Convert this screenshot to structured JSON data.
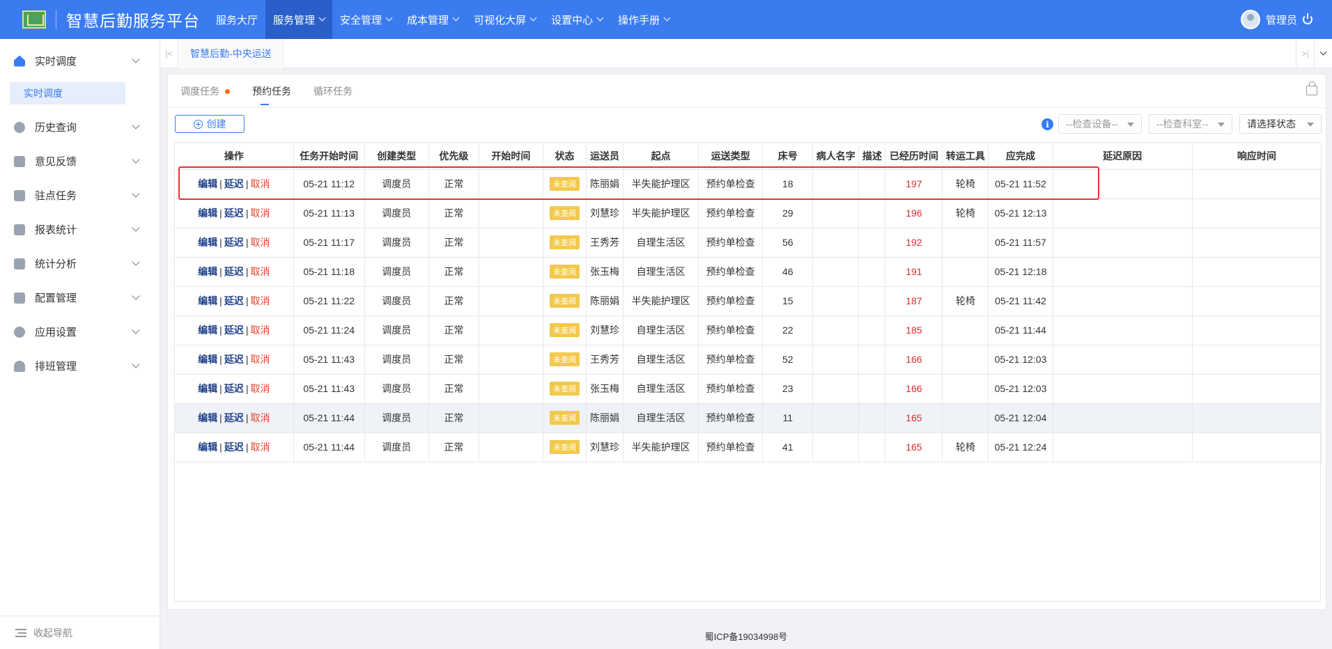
{
  "header": {
    "brand": "智慧后勤服务平台",
    "nav": [
      {
        "label": "服务大厅",
        "dropdown": false,
        "active": false
      },
      {
        "label": "服务管理",
        "dropdown": true,
        "active": true
      },
      {
        "label": "安全管理",
        "dropdown": true,
        "active": false
      },
      {
        "label": "成本管理",
        "dropdown": true,
        "active": false
      },
      {
        "label": "可视化大屏",
        "dropdown": true,
        "active": false
      },
      {
        "label": "设置中心",
        "dropdown": true,
        "active": false
      },
      {
        "label": "操作手册",
        "dropdown": true,
        "active": false
      }
    ],
    "user": "管理员"
  },
  "sidebar": {
    "items": [
      {
        "label": "实时调度",
        "icon": "home-icon",
        "expanded": true
      },
      {
        "label": "历史查询",
        "icon": "history-icon"
      },
      {
        "label": "意见反馈",
        "icon": "edit-icon"
      },
      {
        "label": "驻点任务",
        "icon": "briefcase-icon"
      },
      {
        "label": "报表统计",
        "icon": "bar-chart-icon"
      },
      {
        "label": "统计分析",
        "icon": "analytics-icon"
      },
      {
        "label": "配置管理",
        "icon": "grid-icon"
      },
      {
        "label": "应用设置",
        "icon": "gear-icon"
      },
      {
        "label": "排班管理",
        "icon": "bell-icon"
      }
    ],
    "subitem": "实时调度",
    "collapse": "收起导航"
  },
  "tabsbar": {
    "tab": "智慧后勤-中央运送"
  },
  "subtabs": {
    "dispatch": "调度任务",
    "reserve": "预约任务",
    "loop": "循环任务"
  },
  "toolbar": {
    "create": "创建",
    "device_placeholder": "--检查设备--",
    "dept_placeholder": "--检查科室--",
    "status_placeholder": "请选择状态"
  },
  "table": {
    "headers": [
      "操作",
      "任务开始时间",
      "创建类型",
      "优先级",
      "开始时间",
      "状态",
      "运送员",
      "起点",
      "运送类型",
      "床号",
      "病人名字",
      "描述",
      "已经历时间",
      "转运工具",
      "应完成",
      "延迟原因",
      "响应时间"
    ],
    "ops": {
      "edit": "编辑",
      "delay": "延迟",
      "cancel": "取消"
    },
    "rows": [
      {
        "start": "05-21 11:12",
        "type": "调度员",
        "priority": "正常",
        "begin": "",
        "status": "未查阅",
        "courier": "陈丽娟",
        "origin": "半失能护理区",
        "trans": "预约单检查",
        "bed": "18",
        "patient": "",
        "desc": "",
        "elapsed": "197",
        "tool": "轮椅",
        "due": "05-21 11:52",
        "reason": "",
        "resp": ""
      },
      {
        "start": "05-21 11:13",
        "type": "调度员",
        "priority": "正常",
        "begin": "",
        "status": "未查阅",
        "courier": "刘慧珍",
        "origin": "半失能护理区",
        "trans": "预约单检查",
        "bed": "29",
        "patient": "",
        "desc": "",
        "elapsed": "196",
        "tool": "轮椅",
        "due": "05-21 12:13",
        "reason": "",
        "resp": ""
      },
      {
        "start": "05-21 11:17",
        "type": "调度员",
        "priority": "正常",
        "begin": "",
        "status": "未查阅",
        "courier": "王秀芳",
        "origin": "自理生活区",
        "trans": "预约单检查",
        "bed": "56",
        "patient": "",
        "desc": "",
        "elapsed": "192",
        "tool": "",
        "due": "05-21 11:57",
        "reason": "",
        "resp": ""
      },
      {
        "start": "05-21 11:18",
        "type": "调度员",
        "priority": "正常",
        "begin": "",
        "status": "未查阅",
        "courier": "张玉梅",
        "origin": "自理生活区",
        "trans": "预约单检查",
        "bed": "46",
        "patient": "",
        "desc": "",
        "elapsed": "191",
        "tool": "",
        "due": "05-21 12:18",
        "reason": "",
        "resp": ""
      },
      {
        "start": "05-21 11:22",
        "type": "调度员",
        "priority": "正常",
        "begin": "",
        "status": "未查阅",
        "courier": "陈丽娟",
        "origin": "半失能护理区",
        "trans": "预约单检查",
        "bed": "15",
        "patient": "",
        "desc": "",
        "elapsed": "187",
        "tool": "轮椅",
        "due": "05-21 11:42",
        "reason": "",
        "resp": ""
      },
      {
        "start": "05-21 11:24",
        "type": "调度员",
        "priority": "正常",
        "begin": "",
        "status": "未查阅",
        "courier": "刘慧珍",
        "origin": "自理生活区",
        "trans": "预约单检查",
        "bed": "22",
        "patient": "",
        "desc": "",
        "elapsed": "185",
        "tool": "",
        "due": "05-21 11:44",
        "reason": "",
        "resp": ""
      },
      {
        "start": "05-21 11:43",
        "type": "调度员",
        "priority": "正常",
        "begin": "",
        "status": "未查阅",
        "courier": "王秀芳",
        "origin": "自理生活区",
        "trans": "预约单检查",
        "bed": "52",
        "patient": "",
        "desc": "",
        "elapsed": "166",
        "tool": "",
        "due": "05-21 12:03",
        "reason": "",
        "resp": ""
      },
      {
        "start": "05-21 11:43",
        "type": "调度员",
        "priority": "正常",
        "begin": "",
        "status": "未查阅",
        "courier": "张玉梅",
        "origin": "自理生活区",
        "trans": "预约单检查",
        "bed": "23",
        "patient": "",
        "desc": "",
        "elapsed": "166",
        "tool": "",
        "due": "05-21 12:03",
        "reason": "",
        "resp": ""
      },
      {
        "start": "05-21 11:44",
        "type": "调度员",
        "priority": "正常",
        "begin": "",
        "status": "未查阅",
        "courier": "陈丽娟",
        "origin": "自理生活区",
        "trans": "预约单检查",
        "bed": "11",
        "patient": "",
        "desc": "",
        "elapsed": "165",
        "tool": "",
        "due": "05-21 12:04",
        "reason": "",
        "resp": "",
        "highlight": true
      },
      {
        "start": "05-21 11:44",
        "type": "调度员",
        "priority": "正常",
        "begin": "",
        "status": "未查阅",
        "courier": "刘慧珍",
        "origin": "半失能护理区",
        "trans": "预约单检查",
        "bed": "41",
        "patient": "",
        "desc": "",
        "elapsed": "165",
        "tool": "轮椅",
        "due": "05-21 12:24",
        "reason": "",
        "resp": ""
      }
    ]
  },
  "footer": {
    "icp": "蜀ICP备19034998号"
  },
  "colors": {
    "primary": "#3a7bf0",
    "nav_active": "#2a5fc9",
    "cancel": "#e5432a",
    "badge": "#f2c94c",
    "elapsed": "#d32f2f",
    "highlight_box": "#e0332f"
  }
}
